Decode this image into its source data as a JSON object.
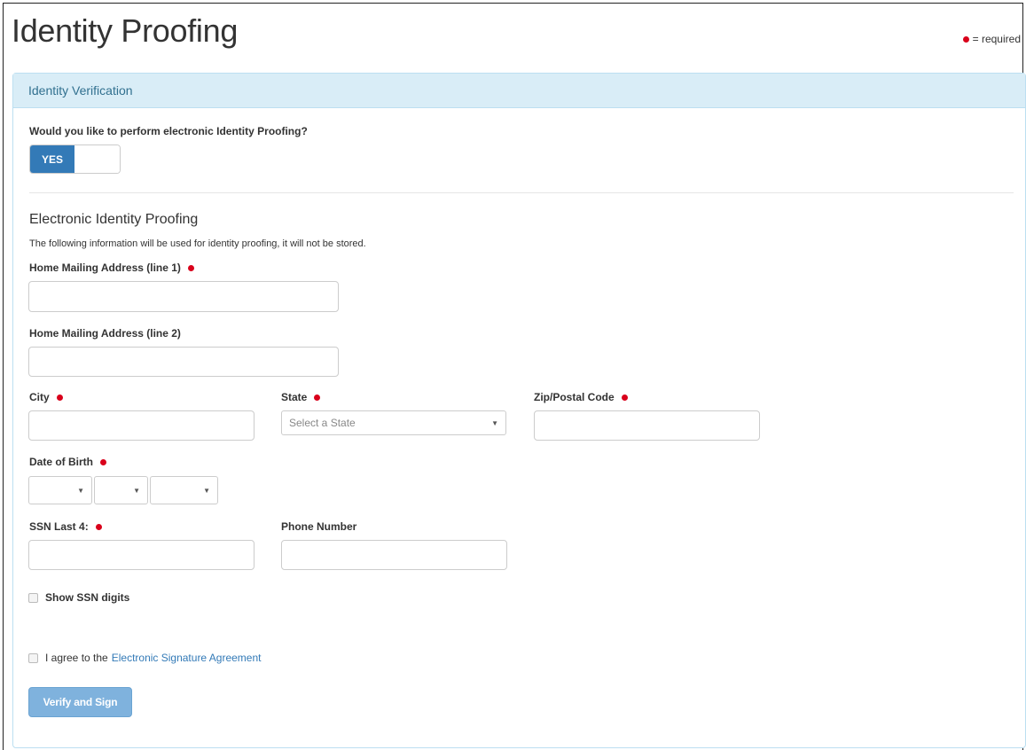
{
  "page": {
    "title": "Identity Proofing",
    "required_note": "= required"
  },
  "panel": {
    "heading": "Identity Verification",
    "question": "Would you like to perform electronic Identity Proofing?",
    "toggle": {
      "on_label": "YES",
      "value": true
    },
    "section_title": "Electronic Identity Proofing",
    "section_desc": "The following information will be used for identity proofing, it will not be stored."
  },
  "fields": {
    "address1": {
      "label": "Home Mailing Address (line 1)",
      "value": "",
      "required": true
    },
    "address2": {
      "label": "Home Mailing Address (line 2)",
      "value": "",
      "required": false
    },
    "city": {
      "label": "City",
      "value": "",
      "required": true
    },
    "state": {
      "label": "State",
      "placeholder": "Select a State",
      "required": true
    },
    "zip": {
      "label": "Zip/Postal Code",
      "value": "",
      "required": true
    },
    "dob": {
      "label": "Date of Birth",
      "required": true,
      "month": "",
      "day": "",
      "year": ""
    },
    "ssn": {
      "label": "SSN Last 4:",
      "value": "",
      "required": true
    },
    "phone": {
      "label": "Phone Number",
      "value": "",
      "required": false
    }
  },
  "show_ssn": {
    "label": "Show SSN digits",
    "checked": false
  },
  "agreement": {
    "prefix": "I agree to the",
    "link_text": "Electronic Signature Agreement",
    "checked": false
  },
  "submit": {
    "label": "Verify and Sign"
  },
  "colors": {
    "accent": "#337ab7",
    "panel_heading_bg": "#d9edf7",
    "panel_heading_text": "#31708f",
    "required_dot": "#d9001b",
    "button_disabled": "#7fb2dd"
  }
}
